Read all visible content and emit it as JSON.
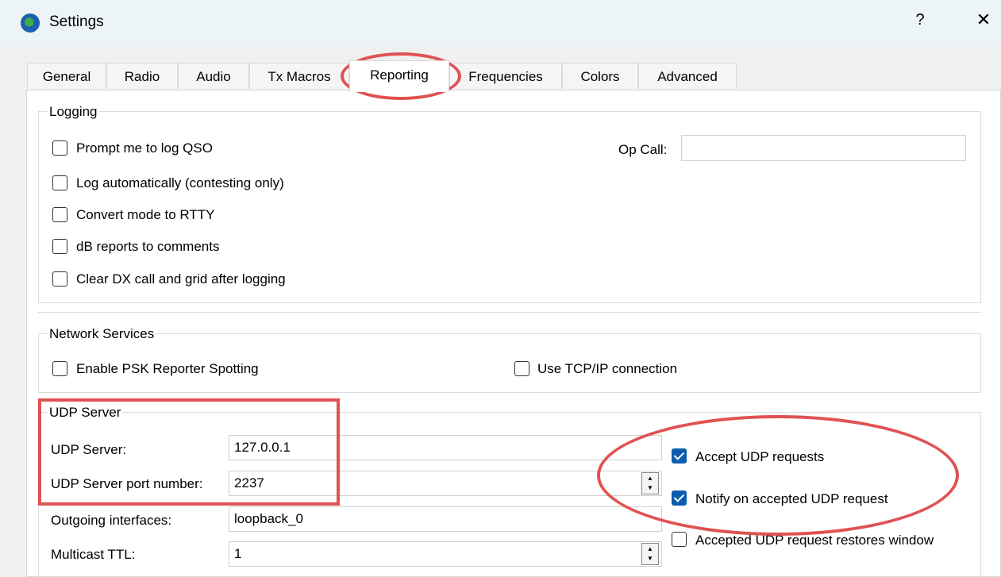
{
  "window": {
    "title": "Settings",
    "help": "?",
    "close": "✕"
  },
  "tabs": [
    {
      "label": "General"
    },
    {
      "label": "Radio"
    },
    {
      "label": "Audio"
    },
    {
      "label": "Tx Macros"
    },
    {
      "label": "Reporting",
      "active": true
    },
    {
      "label": "Frequencies"
    },
    {
      "label": "Colors"
    },
    {
      "label": "Advanced"
    }
  ],
  "logging": {
    "title": "Logging",
    "prompt_log_qso": {
      "label": "Prompt me to log QSO",
      "checked": false
    },
    "log_automatically": {
      "label": "Log automatically (contesting only)",
      "checked": false
    },
    "convert_rtty": {
      "label": "Convert mode to RTTY",
      "checked": false
    },
    "db_reports": {
      "label": "dB reports to comments",
      "checked": false
    },
    "clear_dx": {
      "label": "Clear DX call and grid after logging",
      "checked": false
    },
    "op_call_label": "Op Call:",
    "op_call_value": ""
  },
  "network": {
    "title": "Network Services",
    "psk_reporter": {
      "label": "Enable PSK Reporter Spotting",
      "checked": false
    },
    "tcp_ip": {
      "label": "Use TCP/IP connection",
      "checked": false
    }
  },
  "udp": {
    "title": "UDP Server",
    "server_label": "UDP Server:",
    "server_value": "127.0.0.1",
    "port_label": "UDP Server port number:",
    "port_value": "2237",
    "outgoing_label": "Outgoing interfaces:",
    "outgoing_value": "loopback_0",
    "ttl_label": "Multicast TTL:",
    "ttl_value": "1",
    "accept_requests": {
      "label": "Accept UDP requests",
      "checked": true
    },
    "notify_accepted": {
      "label": "Notify on accepted UDP request",
      "checked": true
    },
    "restores_window": {
      "label": "Accepted UDP request restores window",
      "checked": false
    }
  },
  "colors": {
    "accent_check": "#0b5cad",
    "annotation_red": "#e05252",
    "titlebar": "#edf4f8"
  }
}
